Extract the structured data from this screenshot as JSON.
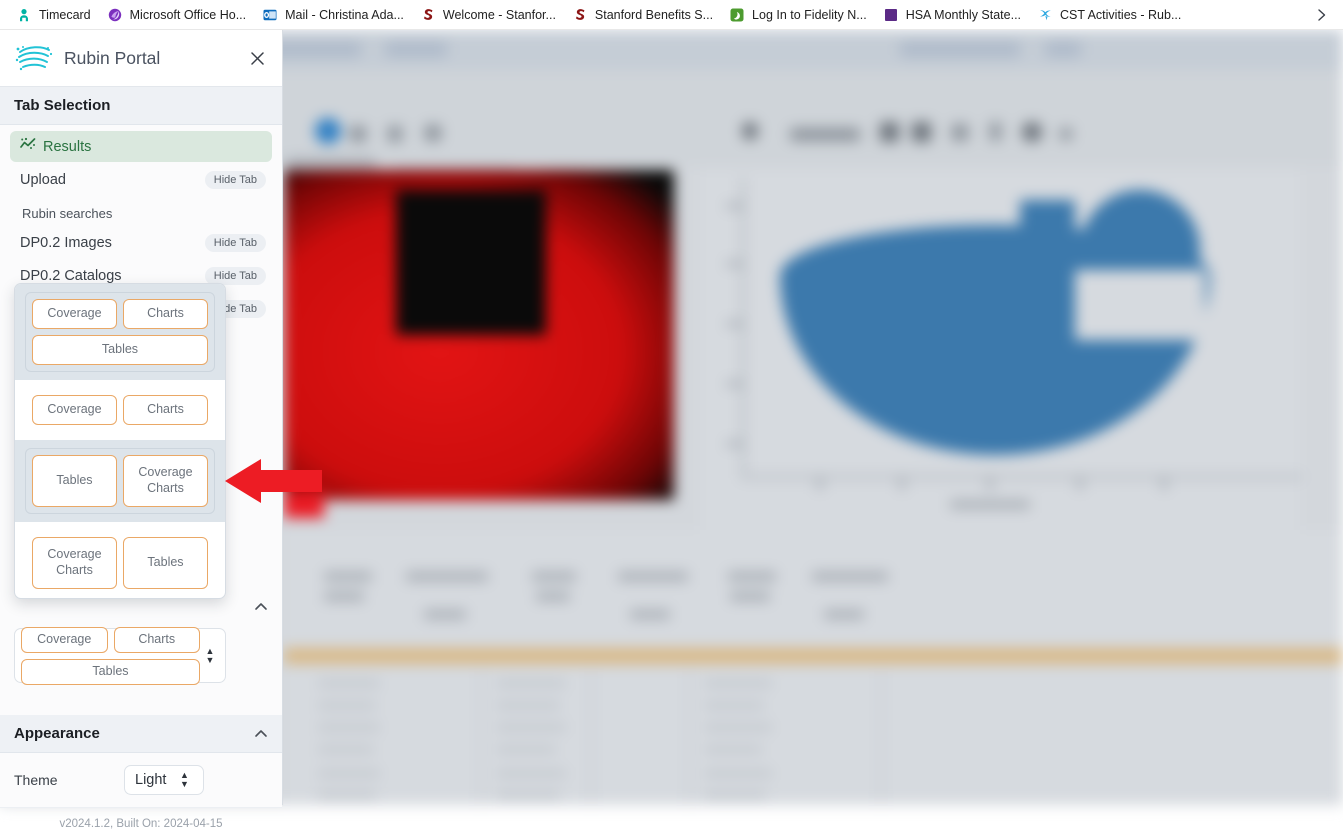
{
  "browser": {
    "bookmarks": [
      {
        "label": "Timecard",
        "icon": "person-icon",
        "color": "#00b3a4"
      },
      {
        "label": "Microsoft Office Ho...",
        "icon": "office-icon",
        "color": "#7b2fbe"
      },
      {
        "label": "Mail - Christina Ada...",
        "icon": "outlook-icon",
        "color": "#0f6cbd"
      },
      {
        "label": "Welcome - Stanfor...",
        "icon": "stanford-icon",
        "color": "#8c1515"
      },
      {
        "label": "Stanford Benefits  S...",
        "icon": "stanford-icon",
        "color": "#8c1515"
      },
      {
        "label": "Log In to Fidelity N...",
        "icon": "fidelity-icon",
        "color": "#4d9b2f"
      },
      {
        "label": "HSA Monthly State...",
        "icon": "square-icon",
        "color": "#5b2a86"
      },
      {
        "label": "CST Activities - Rub...",
        "icon": "rubin-x-icon",
        "color": "#2ea8e0"
      }
    ],
    "overflow_icon": "chevron-right-icon"
  },
  "sidebar": {
    "app_title": "Rubin Portal",
    "logo_icon": "rubin-logo-icon",
    "close_icon": "close-icon",
    "tab_selection": {
      "title": "Tab Selection",
      "collapse_icon": "chevron-up-icon",
      "items": [
        {
          "label": "Results",
          "active": true,
          "icon": "results-chart-icon",
          "hide_label": null
        },
        {
          "label": "Upload",
          "active": false,
          "icon": null,
          "hide_label": "Hide Tab"
        }
      ],
      "group_label": "Rubin searches",
      "search_items": [
        {
          "label": "DP0.2 Images",
          "hide_label": "Hide Tab"
        },
        {
          "label": "DP0.2 Catalogs",
          "hide_label": "Hide Tab"
        },
        {
          "label": "",
          "hide_label": "Hide Tab"
        }
      ]
    },
    "layout_picker": {
      "selected": {
        "row1": [
          "Coverage",
          "Charts"
        ],
        "row2": [
          "Tables"
        ]
      },
      "chevrons_icon": "select-updown-icon",
      "options": [
        {
          "highlighted": true,
          "row1": [
            "Coverage",
            "Charts"
          ],
          "row2": [
            "Tables"
          ]
        },
        {
          "highlighted": false,
          "row1": [
            "Coverage",
            "Charts"
          ],
          "row2": []
        },
        {
          "highlighted": true,
          "row1": [
            "Tables",
            "Coverage Charts"
          ],
          "row2": []
        },
        {
          "highlighted": false,
          "row1": [
            "Coverage Charts",
            "Tables"
          ],
          "row2": []
        }
      ]
    },
    "appearance": {
      "title": "Appearance",
      "collapse_icon": "chevron-up-icon",
      "theme_label": "Theme",
      "theme_value": "Light",
      "theme_chevrons_icon": "select-updown-icon"
    },
    "version": "v2024.1.2, Built On: 2024-04-15"
  },
  "annotation": {
    "arrow_icon": "left-arrow-icon",
    "arrow_color": "#ed1c24"
  },
  "colors": {
    "accent_orange": "#eaa866",
    "active_tab_bg": "#dae8de",
    "active_tab_text": "#2a7341",
    "section_bg": "#eef1f5",
    "sidebar_bg": "#fbfbfc",
    "backdrop": "#d3d7dc",
    "chart_blue": "#3c79ac",
    "image_red": "#cc0d0d"
  }
}
